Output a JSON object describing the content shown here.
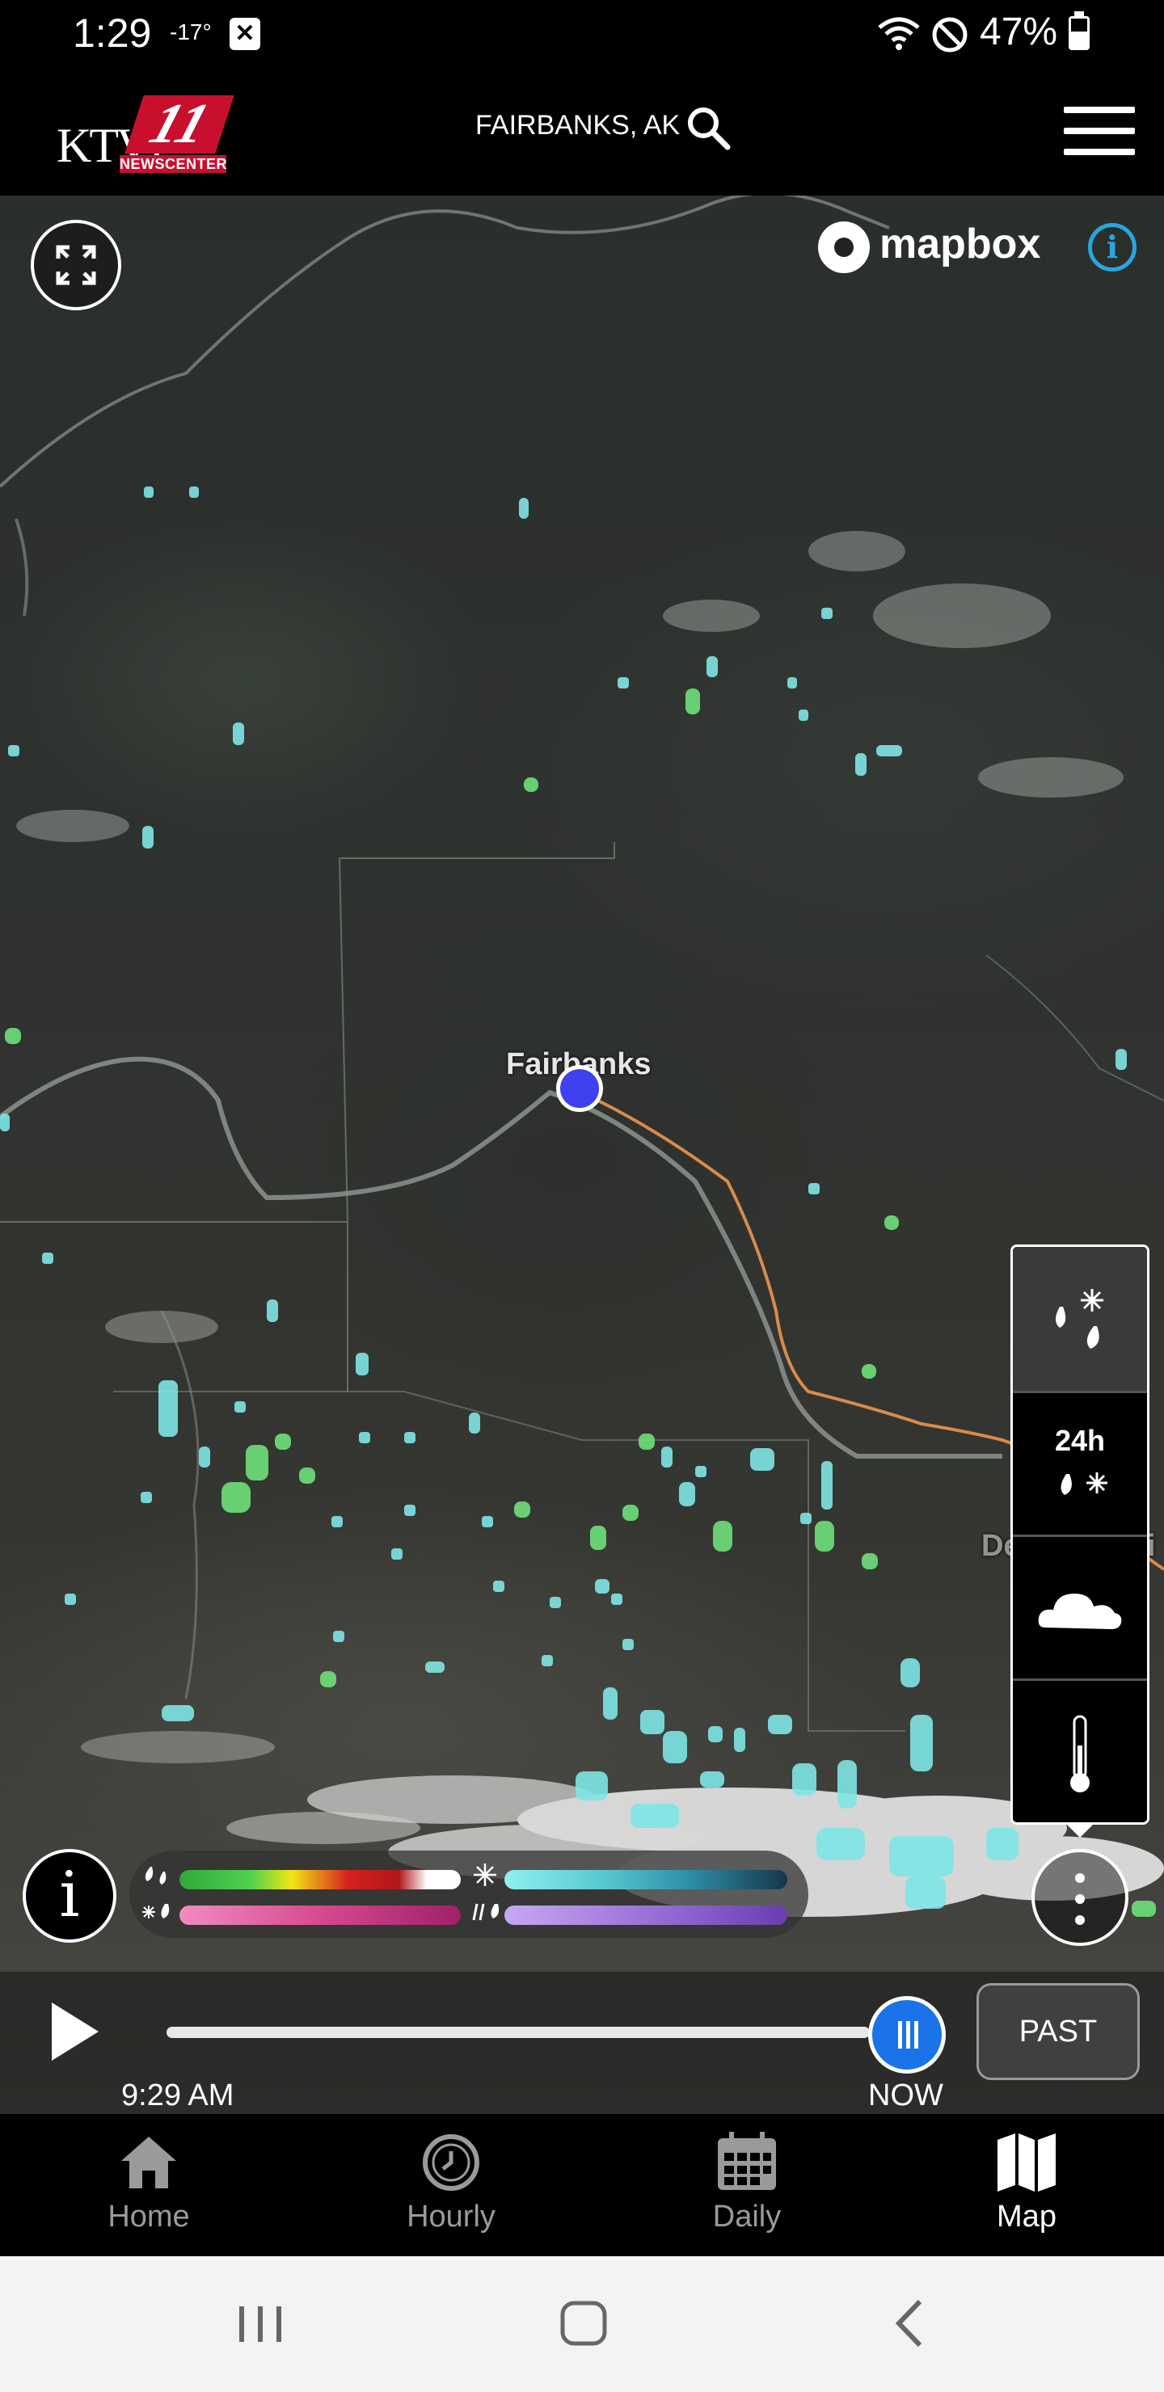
{
  "status_bar": {
    "time": "1:29",
    "temperature": "-17°",
    "battery_percent": "47%"
  },
  "header": {
    "logo_text": "KTVF",
    "logo_number": "11",
    "logo_subtitle": "NEWSCENTER",
    "location": "FAIRBANKS, AK",
    "search_icon": "search-icon",
    "menu_icon": "hamburger-menu-icon"
  },
  "map": {
    "attribution": "mapbox",
    "city_main": "Fairbanks",
    "city_secondary": "Delta Juncti",
    "colors": {
      "location_dot": "#4040f0",
      "road": "#d98b4b",
      "precip": "#7fe6e6",
      "precip_green": "#6ee07a"
    }
  },
  "layers": {
    "items": [
      {
        "name": "precipitation",
        "icon": "rain-snow-icon",
        "active": true
      },
      {
        "name": "24h precipitation",
        "label": "24h",
        "icon": "rain-snow-icon",
        "active": false
      },
      {
        "name": "clouds",
        "icon": "cloud-icon",
        "active": false
      },
      {
        "name": "temperature",
        "icon": "thermometer-icon",
        "active": false
      }
    ]
  },
  "legend": {
    "rain_colors": [
      "#4ed14e",
      "#f2e614",
      "#d42020",
      "#ffffff"
    ],
    "snow_colors": [
      "#8ff0f0",
      "#2e8fa8",
      "#15364a"
    ],
    "mix_colors": [
      "#f08cc0",
      "#a0206a"
    ],
    "ice_colors": [
      "#c7a8f2",
      "#6a3db0"
    ]
  },
  "playback": {
    "time": "9:29 AM",
    "now_label": "NOW",
    "past_label": "PAST",
    "progress": 1.0
  },
  "bottom_nav": {
    "items": [
      {
        "label": "Home",
        "icon": "home-icon",
        "active": false
      },
      {
        "label": "Hourly",
        "icon": "clock-icon",
        "active": false
      },
      {
        "label": "Daily",
        "icon": "calendar-icon",
        "active": false
      },
      {
        "label": "Map",
        "icon": "map-icon",
        "active": true
      }
    ]
  }
}
